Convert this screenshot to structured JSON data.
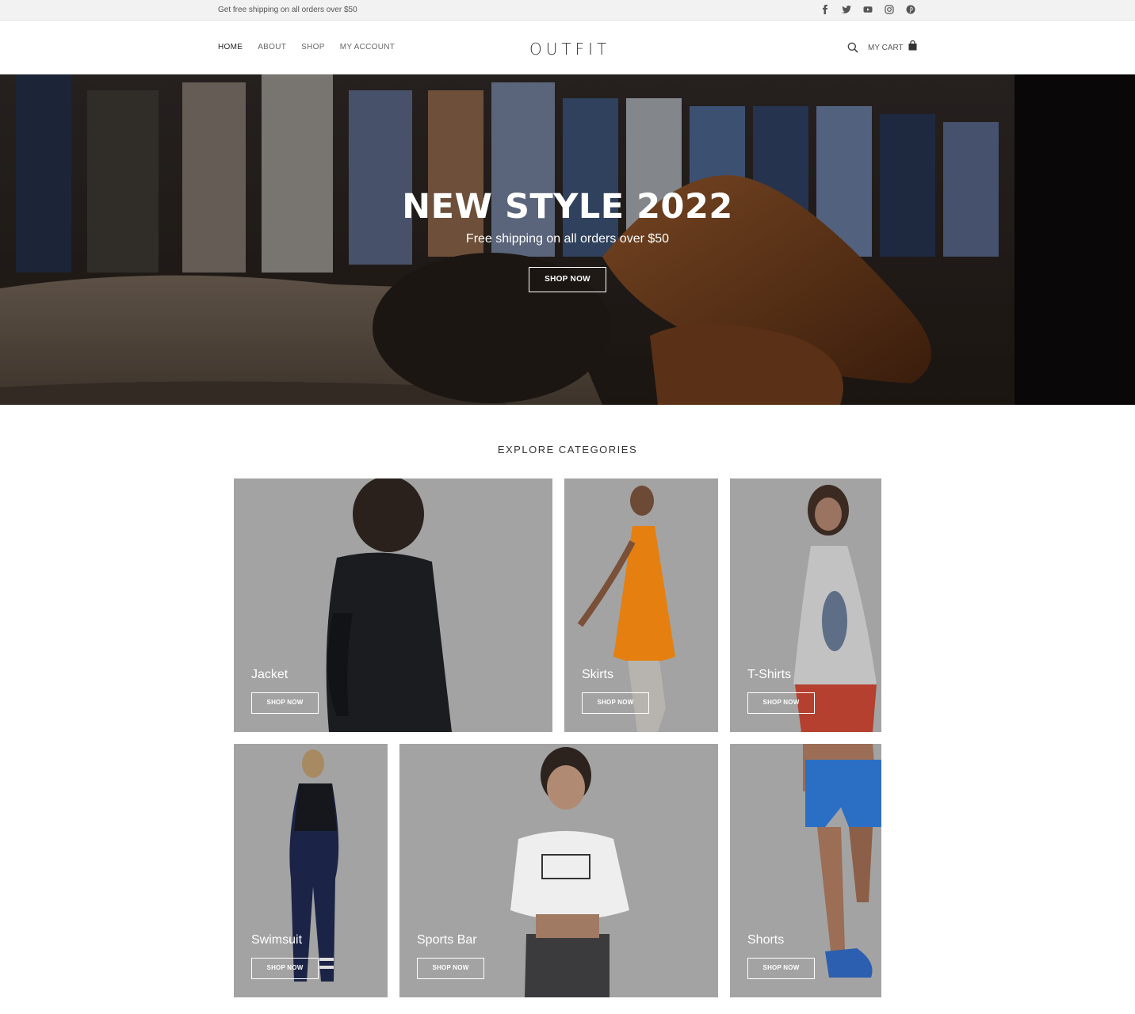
{
  "topbar": {
    "promo": "Get free shipping on all orders over $50",
    "social_icons": [
      "facebook-icon",
      "twitter-icon",
      "youtube-icon",
      "instagram-icon",
      "pinterest-icon"
    ]
  },
  "header": {
    "nav": [
      "HOME",
      "ABOUT",
      "SHOP",
      "MY ACCOUNT"
    ],
    "active_nav": "HOME",
    "logo": "OUTFIT",
    "cart_label": "MY CART"
  },
  "hero": {
    "title": "NEW STYLE 2022",
    "subtitle": "Free shipping on all orders over $50",
    "button": "SHOP NOW"
  },
  "categories": {
    "title": "EXPLORE CATEGORIES",
    "items": [
      {
        "name": "Jacket",
        "button": "SHOP NOW"
      },
      {
        "name": "Skirts",
        "button": "SHOP NOW"
      },
      {
        "name": "T-Shirts",
        "button": "SHOP NOW"
      },
      {
        "name": "Swimsuit",
        "button": "SHOP NOW"
      },
      {
        "name": "Sports Bar",
        "button": "SHOP NOW"
      },
      {
        "name": "Shorts",
        "button": "SHOP NOW"
      }
    ]
  },
  "colors": {
    "topbar_bg": "#f2f2f2",
    "card_bg": "#a6a6a6",
    "hero_overlay": "#000000"
  }
}
